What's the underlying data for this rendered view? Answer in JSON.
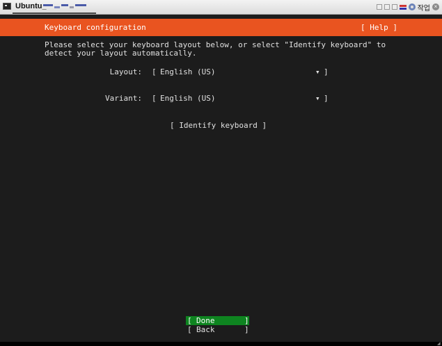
{
  "window": {
    "title": "Ubuntu_",
    "icon": "terminal-icon",
    "work_label": "작업"
  },
  "installer": {
    "header_title": "Keyboard configuration",
    "help_label": "[ Help ]",
    "instructions_line1": "Please select your keyboard layout below, or select \"Identify keyboard\" to",
    "instructions_line2": "detect your layout automatically.",
    "layout": {
      "label": "Layout:",
      "open_bracket": "[",
      "value": "English (US)",
      "arrow": "▾",
      "close_bracket": "]"
    },
    "variant": {
      "label": "Variant:",
      "open_bracket": "[",
      "value": "English (US)",
      "arrow": "▾",
      "close_bracket": "]"
    },
    "identify_label": "[ Identify keyboard ]",
    "done": {
      "open_bracket": "[",
      "label": "Done",
      "close_bracket": "]"
    },
    "back": {
      "open_bracket": "[",
      "label": "Back",
      "close_bracket": "]"
    }
  },
  "colors": {
    "header_accent": "#e95420",
    "selected_button": "#0e8420",
    "background": "#1c1c1c"
  }
}
